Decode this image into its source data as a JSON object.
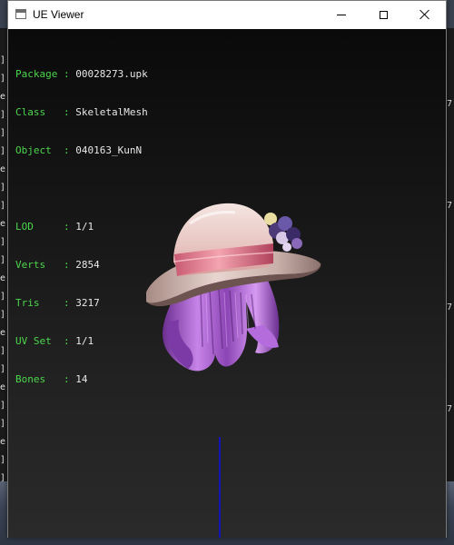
{
  "window": {
    "title": "UE Viewer"
  },
  "info": {
    "package": {
      "key": "Package",
      "sep": ":",
      "value": "00028273.upk"
    },
    "class": {
      "key": "Class  ",
      "sep": ":",
      "value": "SkeletalMesh"
    },
    "object": {
      "key": "Object ",
      "sep": ":",
      "value": "040163_KunN"
    },
    "lod": {
      "key": "LOD    ",
      "sep": ":",
      "value": "1/1"
    },
    "verts": {
      "key": "Verts  ",
      "sep": ":",
      "value": "2854"
    },
    "tris": {
      "key": "Tris   ",
      "sep": ":",
      "value": "3217"
    },
    "uvset": {
      "key": "UV Set ",
      "sep": ":",
      "value": "1/1"
    },
    "bones": {
      "key": "Bones  ",
      "sep": ":",
      "value": "14"
    }
  },
  "colors": {
    "label": "#4cd64c",
    "value": "#e8e8e8",
    "axis": "#1414b8"
  },
  "background": {
    "left_marks": [
      "]",
      "]",
      "e",
      "]",
      "]",
      "]",
      "e",
      "]",
      "]",
      "e",
      "]",
      "]",
      "e",
      "]",
      "]",
      "e",
      "]",
      "]",
      "e",
      "]",
      "]",
      "e",
      "]",
      "]",
      "e",
      "]"
    ],
    "right_marks": [
      "7",
      "7",
      "7",
      "7",
      "7"
    ]
  }
}
